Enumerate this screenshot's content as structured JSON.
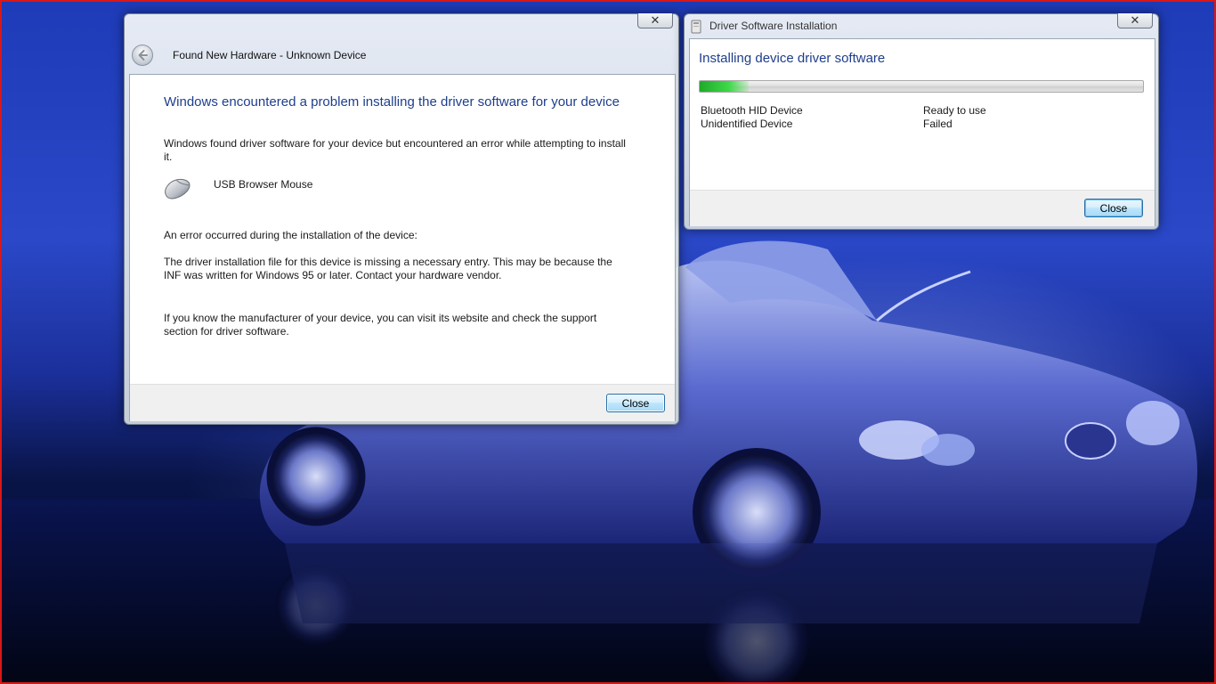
{
  "colors": {
    "heading": "#1e3e8c",
    "progress_green": "#2fc43a",
    "frame_red": "#d81818"
  },
  "hardware_window": {
    "title": "Found New Hardware - Unknown Device",
    "back_icon": "back-arrow-icon",
    "close_glyph": "✕",
    "heading": "Windows encountered a problem installing the driver software for your device",
    "intro": "Windows found driver software for your device but encountered an error while attempting to install it.",
    "device_icon": "mouse-icon",
    "device_name": "USB Browser Mouse",
    "error_title": "An error occurred during the installation of the device:",
    "error_detail": "The driver installation file for this device is missing a necessary entry. This may be because the INF was written for Windows 95 or later. Contact your hardware vendor.",
    "support_text": "If you know the manufacturer of your device, you can visit its website and check the support section for driver software.",
    "close_button": "Close"
  },
  "driver_window": {
    "title": "Driver Software Installation",
    "title_icon": "installer-icon",
    "close_glyph": "✕",
    "heading": "Installing device driver software",
    "progress": 0.11,
    "devices": [
      {
        "name": "Bluetooth HID Device",
        "status": "Ready to use"
      },
      {
        "name": "Unidentified Device",
        "status": "Failed"
      }
    ],
    "close_button": "Close"
  }
}
